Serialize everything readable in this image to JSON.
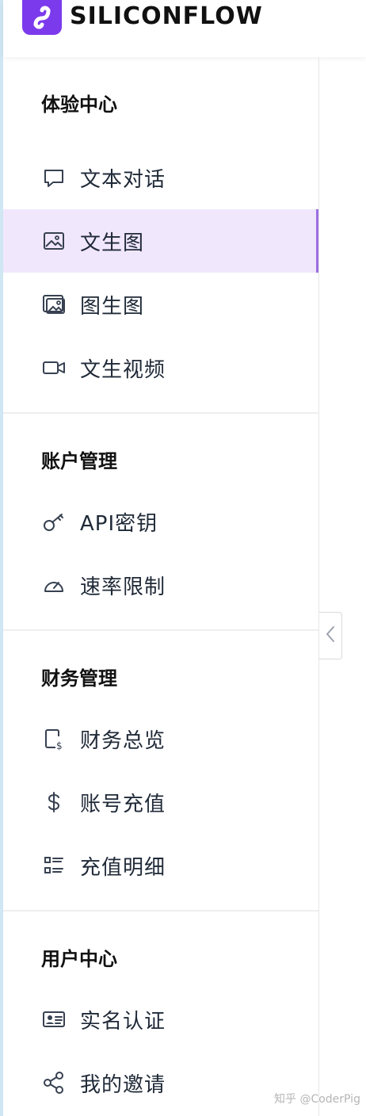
{
  "brand": {
    "name": "SILICONFLOW",
    "logo_color": "#7c3aed"
  },
  "sections": [
    {
      "title": "体验中心",
      "items": [
        {
          "label": "文本对话",
          "icon": "chat-bubble-icon",
          "active": false
        },
        {
          "label": "文生图",
          "icon": "image-icon",
          "active": true
        },
        {
          "label": "图生图",
          "icon": "images-icon",
          "active": false
        },
        {
          "label": "文生视频",
          "icon": "video-camera-icon",
          "active": false
        }
      ]
    },
    {
      "title": "账户管理",
      "items": [
        {
          "label": "API密钥",
          "icon": "key-icon",
          "active": false
        },
        {
          "label": "速率限制",
          "icon": "speedometer-icon",
          "active": false
        }
      ]
    },
    {
      "title": "财务管理",
      "items": [
        {
          "label": "财务总览",
          "icon": "phone-dollar-icon",
          "active": false
        },
        {
          "label": "账号充值",
          "icon": "dollar-icon",
          "active": false
        },
        {
          "label": "充值明细",
          "icon": "list-icon",
          "active": false
        }
      ]
    },
    {
      "title": "用户中心",
      "items": [
        {
          "label": "实名认证",
          "icon": "id-card-icon",
          "active": false
        },
        {
          "label": "我的邀请",
          "icon": "share-icon",
          "active": false
        }
      ]
    }
  ],
  "collapse": {
    "icon": "chevron-left-icon"
  },
  "watermark": "知乎 @CoderPig",
  "colors": {
    "active_bg": "#f1e7fd",
    "active_bar": "#9b6fe0",
    "accent": "#7c3aed"
  }
}
